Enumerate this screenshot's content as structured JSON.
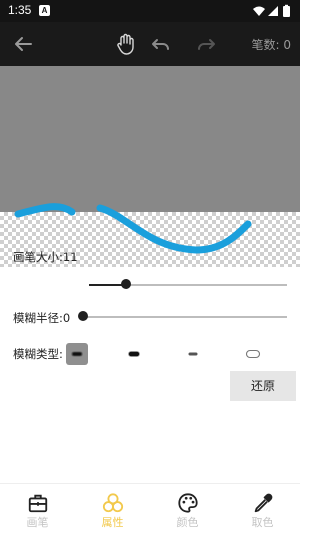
{
  "status_bar": {
    "time": "1:35",
    "app_icon_letter": "A"
  },
  "toolbar": {
    "stroke_count_label": "笔数:",
    "stroke_count_value": "0",
    "icons": [
      "back-arrow-icon",
      "hand-icon",
      "undo-icon",
      "redo-icon"
    ]
  },
  "canvas": {
    "mask_color": "#888888",
    "stroke_color": "#1a9fdc"
  },
  "settings": {
    "brush_size": {
      "label": "画笔大小:",
      "value": "11",
      "level": 0.18
    },
    "blur_radius": {
      "label": "模糊半径:",
      "value": "0",
      "level": 0.0
    },
    "blur_type": {
      "label": "模糊类型:",
      "options": [
        "normal",
        "solid",
        "inner",
        "outer"
      ],
      "selected": "normal"
    },
    "reset_label": "还原"
  },
  "bottom_nav": {
    "items": [
      {
        "label": "画笔",
        "icon": "toolbox-icon",
        "active": false
      },
      {
        "label": "属性",
        "icon": "circles-icon",
        "active": true
      },
      {
        "label": "颜色",
        "icon": "palette-icon",
        "active": false
      },
      {
        "label": "取色",
        "icon": "eyedropper-icon",
        "active": false
      }
    ],
    "active_color": "#f2c94c"
  }
}
